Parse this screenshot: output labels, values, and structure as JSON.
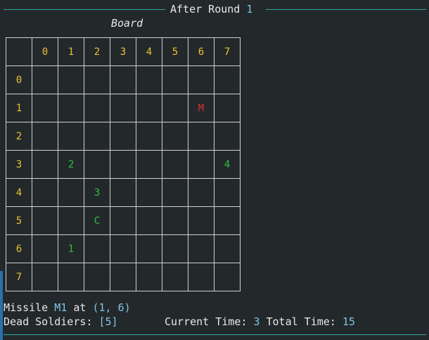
{
  "header": {
    "prefix": "After Round ",
    "round": "1"
  },
  "board": {
    "caption": "Board",
    "columns": [
      "0",
      "1",
      "2",
      "3",
      "4",
      "5",
      "6",
      "7"
    ],
    "rows": [
      {
        "label": "0",
        "cells": [
          "",
          "",
          "",
          "",
          "",
          "",
          "",
          ""
        ]
      },
      {
        "label": "1",
        "cells": [
          "",
          "",
          "",
          "",
          "",
          "",
          "M",
          ""
        ]
      },
      {
        "label": "2",
        "cells": [
          "",
          "",
          "",
          "",
          "",
          "",
          "",
          ""
        ]
      },
      {
        "label": "3",
        "cells": [
          "",
          "2",
          "",
          "",
          "",
          "",
          "",
          "4"
        ]
      },
      {
        "label": "4",
        "cells": [
          "",
          "",
          "3",
          "",
          "",
          "",
          "",
          ""
        ]
      },
      {
        "label": "5",
        "cells": [
          "",
          "",
          "C",
          "",
          "",
          "",
          "",
          ""
        ]
      },
      {
        "label": "6",
        "cells": [
          "",
          "1",
          "",
          "",
          "",
          "",
          "",
          ""
        ]
      },
      {
        "label": "7",
        "cells": [
          "",
          "",
          "",
          "",
          "",
          "",
          "",
          ""
        ]
      }
    ],
    "colors": {
      "axis": "#e9c234",
      "soldier": "#2fbf3e",
      "missile": "#e03030"
    }
  },
  "status": {
    "missile_label": "Missile ",
    "missile_id": "M1",
    "at_label": " at ",
    "missile_pos": "(1, 6)",
    "dead_label": "Dead Soldiers: ",
    "dead_value": "[5]",
    "current_label": "Current Time: ",
    "current_value": "3",
    "total_label": " Total Time: ",
    "total_value": "15"
  },
  "accent_color": "#7ec6e6",
  "rule_color": "#2fa89a"
}
